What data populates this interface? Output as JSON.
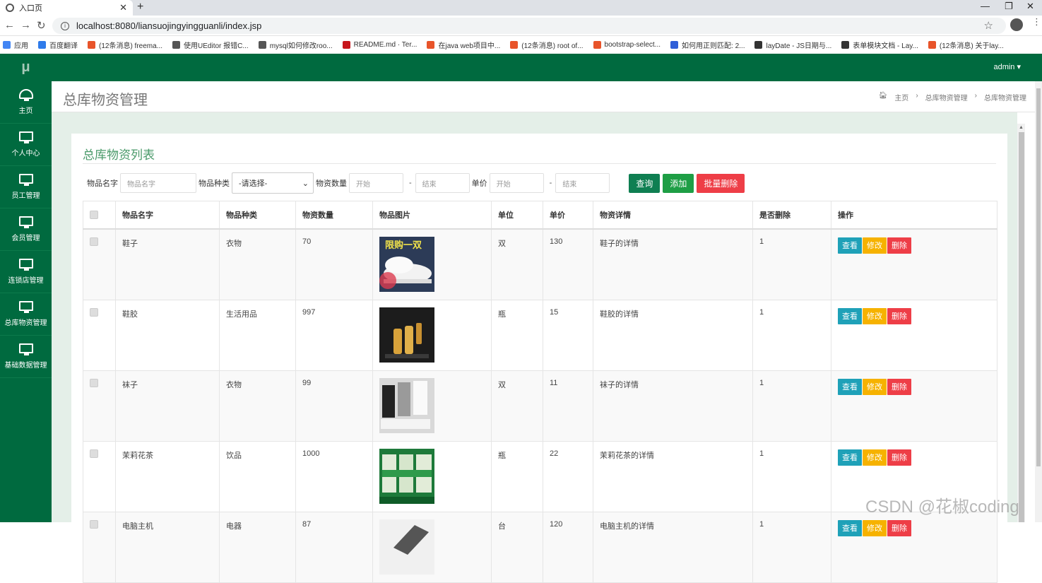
{
  "browser": {
    "tab_title": "入口页",
    "url": "localhost:8080/liansuojingyingguanli/index.jsp",
    "bookmarks": [
      {
        "label": "应用",
        "color": "#4285f4"
      },
      {
        "label": "百度翻译",
        "color": "#2f7bea"
      },
      {
        "label": "(12条消息) freema...",
        "color": "#e8542a"
      },
      {
        "label": "使用UEditor 报错C...",
        "color": "#555555"
      },
      {
        "label": "mysql如何修改roo...",
        "color": "#555555"
      },
      {
        "label": "README.md · Ter...",
        "color": "#c7161c"
      },
      {
        "label": "在java web项目中...",
        "color": "#e8542a"
      },
      {
        "label": "(12条消息) root of...",
        "color": "#e8542a"
      },
      {
        "label": "bootstrap-select...",
        "color": "#e8542a"
      },
      {
        "label": "如何用正则匹配: 2...",
        "color": "#2f5fd8"
      },
      {
        "label": "layDate - JS日期与...",
        "color": "#333333"
      },
      {
        "label": "表单模块文档 - Lay...",
        "color": "#333333"
      },
      {
        "label": "(12条消息) 关于lay...",
        "color": "#e8542a"
      }
    ]
  },
  "app": {
    "logo": "μ",
    "user": "admin ▾",
    "sidebar": [
      {
        "label": "主页",
        "icon": "dashboard-icon"
      },
      {
        "label": "个人中心",
        "icon": "monitor-icon"
      },
      {
        "label": "员工管理",
        "icon": "monitor-icon"
      },
      {
        "label": "会员管理",
        "icon": "monitor-icon"
      },
      {
        "label": "连锁店管理",
        "icon": "monitor-icon"
      },
      {
        "label": "总库物资管理",
        "icon": "monitor-icon"
      },
      {
        "label": "基础数据管理",
        "icon": "monitor-icon"
      }
    ],
    "page_title": "总库物资管理",
    "breadcrumb": [
      "主页",
      "总库物资管理",
      "总库物资管理"
    ],
    "card_title": "总库物资列表",
    "filters": {
      "name_label": "物品名字",
      "name_placeholder": "物品名字",
      "type_label": "物品种类",
      "type_selected": "-请选择-",
      "qty_label": "物资数量",
      "qty_start": "开始",
      "qty_end": "结束",
      "price_label": "单价",
      "price_start": "开始",
      "price_end": "结束",
      "query": "查询",
      "add": "添加",
      "batch_delete": "批量删除"
    },
    "table": {
      "headers": [
        "物品名字",
        "物品种类",
        "物资数量",
        "物品图片",
        "单位",
        "单价",
        "物资详情",
        "是否删除",
        "操作"
      ],
      "action_labels": {
        "view": "查看",
        "edit": "修改",
        "delete": "删除"
      },
      "rows": [
        {
          "name": "鞋子",
          "type": "衣物",
          "qty": "70",
          "image": "shoe-image",
          "image_text": "限购一双",
          "unit": "双",
          "price": "130",
          "detail": "鞋子的详情",
          "deleted": "1"
        },
        {
          "name": "鞋胶",
          "type": "生活用品",
          "qty": "997",
          "image": "glue-bottles-image",
          "image_text": "",
          "unit": "瓶",
          "price": "15",
          "detail": "鞋胶的详情",
          "deleted": "1"
        },
        {
          "name": "袜子",
          "type": "衣物",
          "qty": "99",
          "image": "socks-image",
          "image_text": "",
          "unit": "双",
          "price": "11",
          "detail": "袜子的详情",
          "deleted": "1"
        },
        {
          "name": "茉莉花茶",
          "type": "饮品",
          "qty": "1000",
          "image": "tea-jars-image",
          "image_text": "",
          "unit": "瓶",
          "price": "22",
          "detail": "茉莉花茶的详情",
          "deleted": "1"
        },
        {
          "name": "电脑主机",
          "type": "电器",
          "qty": "87",
          "image": "computer-image",
          "image_text": "",
          "unit": "台",
          "price": "120",
          "detail": "电脑主机的详情",
          "deleted": "1"
        }
      ]
    },
    "watermark": "CSDN @花椒coding",
    "colors": {
      "sidebar": "#006a3f",
      "view": "#1fa1b8",
      "edit": "#f6b200",
      "delete": "#ee3e47",
      "query": "#0f7f52",
      "add": "#1e9e45",
      "batch": "#ee3e47"
    }
  }
}
